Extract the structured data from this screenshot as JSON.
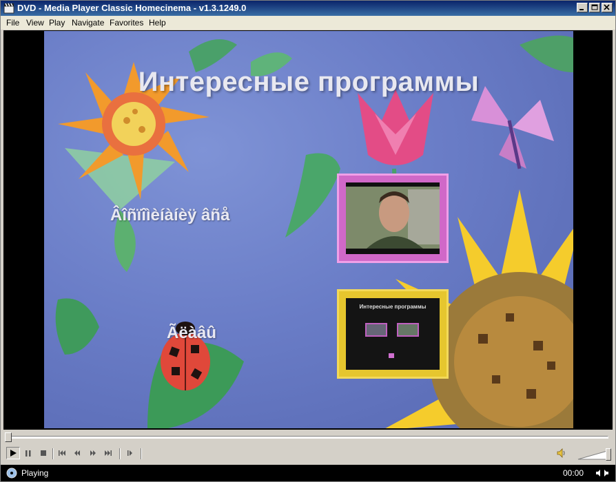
{
  "window": {
    "title": "DVD - Media Player Classic Homecinema - v1.3.1249.0"
  },
  "menu": {
    "items": [
      "File",
      "View",
      "Play",
      "Navigate",
      "Favorites",
      "Help"
    ]
  },
  "dvd_menu": {
    "title": "Интересные программы",
    "option_1": "Âîñïîìèíàíèÿ âñå",
    "option_2": "Ãëàâû",
    "thumb_2_title": "Интересные программы"
  },
  "controls": {
    "icons": [
      "play-icon",
      "pause-icon",
      "stop-icon",
      "skip-back-icon",
      "rewind-icon",
      "fast-forward-icon",
      "skip-forward-icon",
      "frame-step-icon",
      "volume-icon"
    ],
    "seek_fraction": 0,
    "volume_fraction": 1
  },
  "status": {
    "state": "Playing",
    "time": "00:00"
  }
}
